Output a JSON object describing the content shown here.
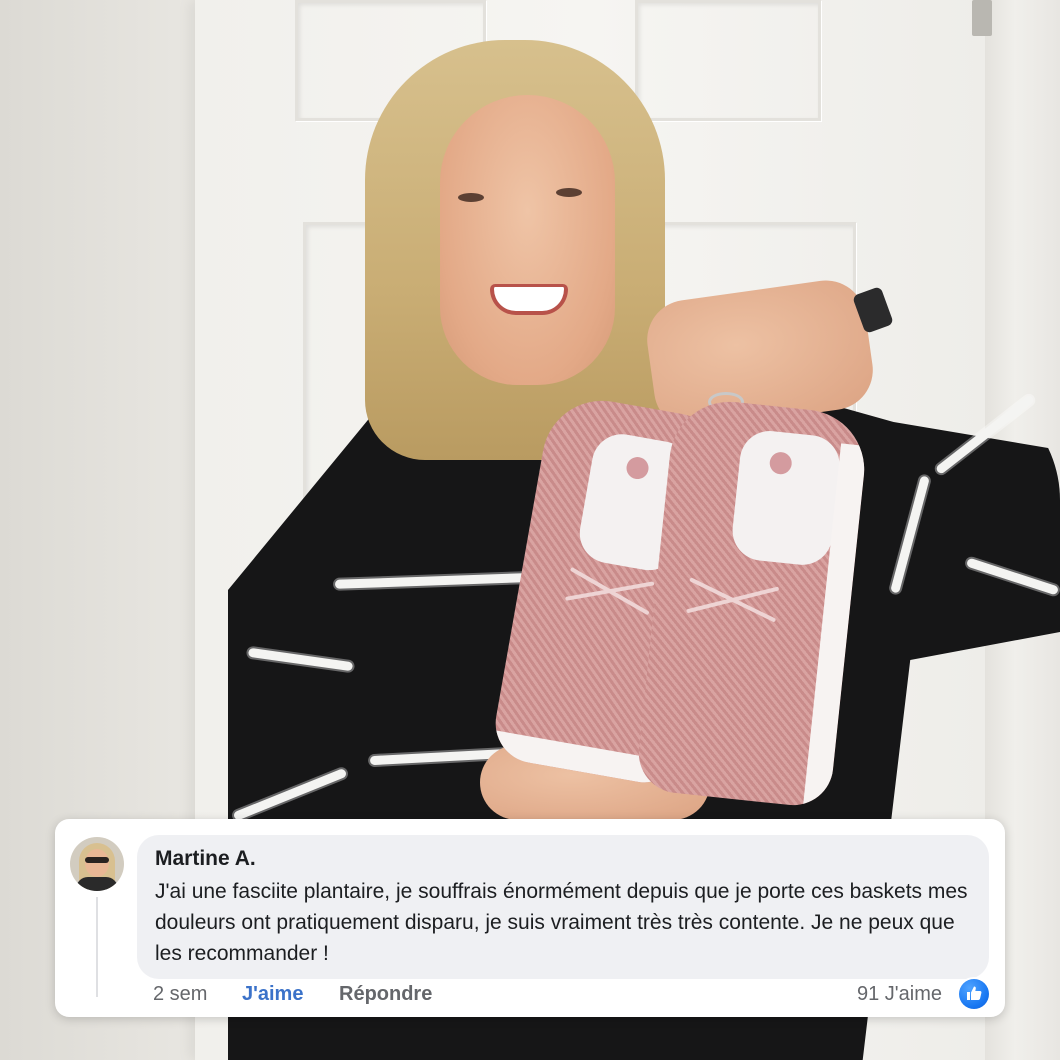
{
  "comment": {
    "author": "Martine A.",
    "text": "J'ai une fasciite plantaire, je souffrais énormément depuis que je porte ces baskets mes douleurs ont pratiquement disparu, je suis vraiment très très contente. Je ne peux que les recommander !",
    "time": "2 sem",
    "like_label": "J'aime",
    "reply_label": "Répondre",
    "like_count": "91 J'aime"
  },
  "icons": {
    "avatar": "profile-photo",
    "reaction": "thumbs-up-icon"
  },
  "colors": {
    "link_blue": "#3b72c9",
    "reaction_blue": "#1877f2",
    "bubble_gray": "#eff0f3",
    "meta_gray": "#65676b"
  }
}
